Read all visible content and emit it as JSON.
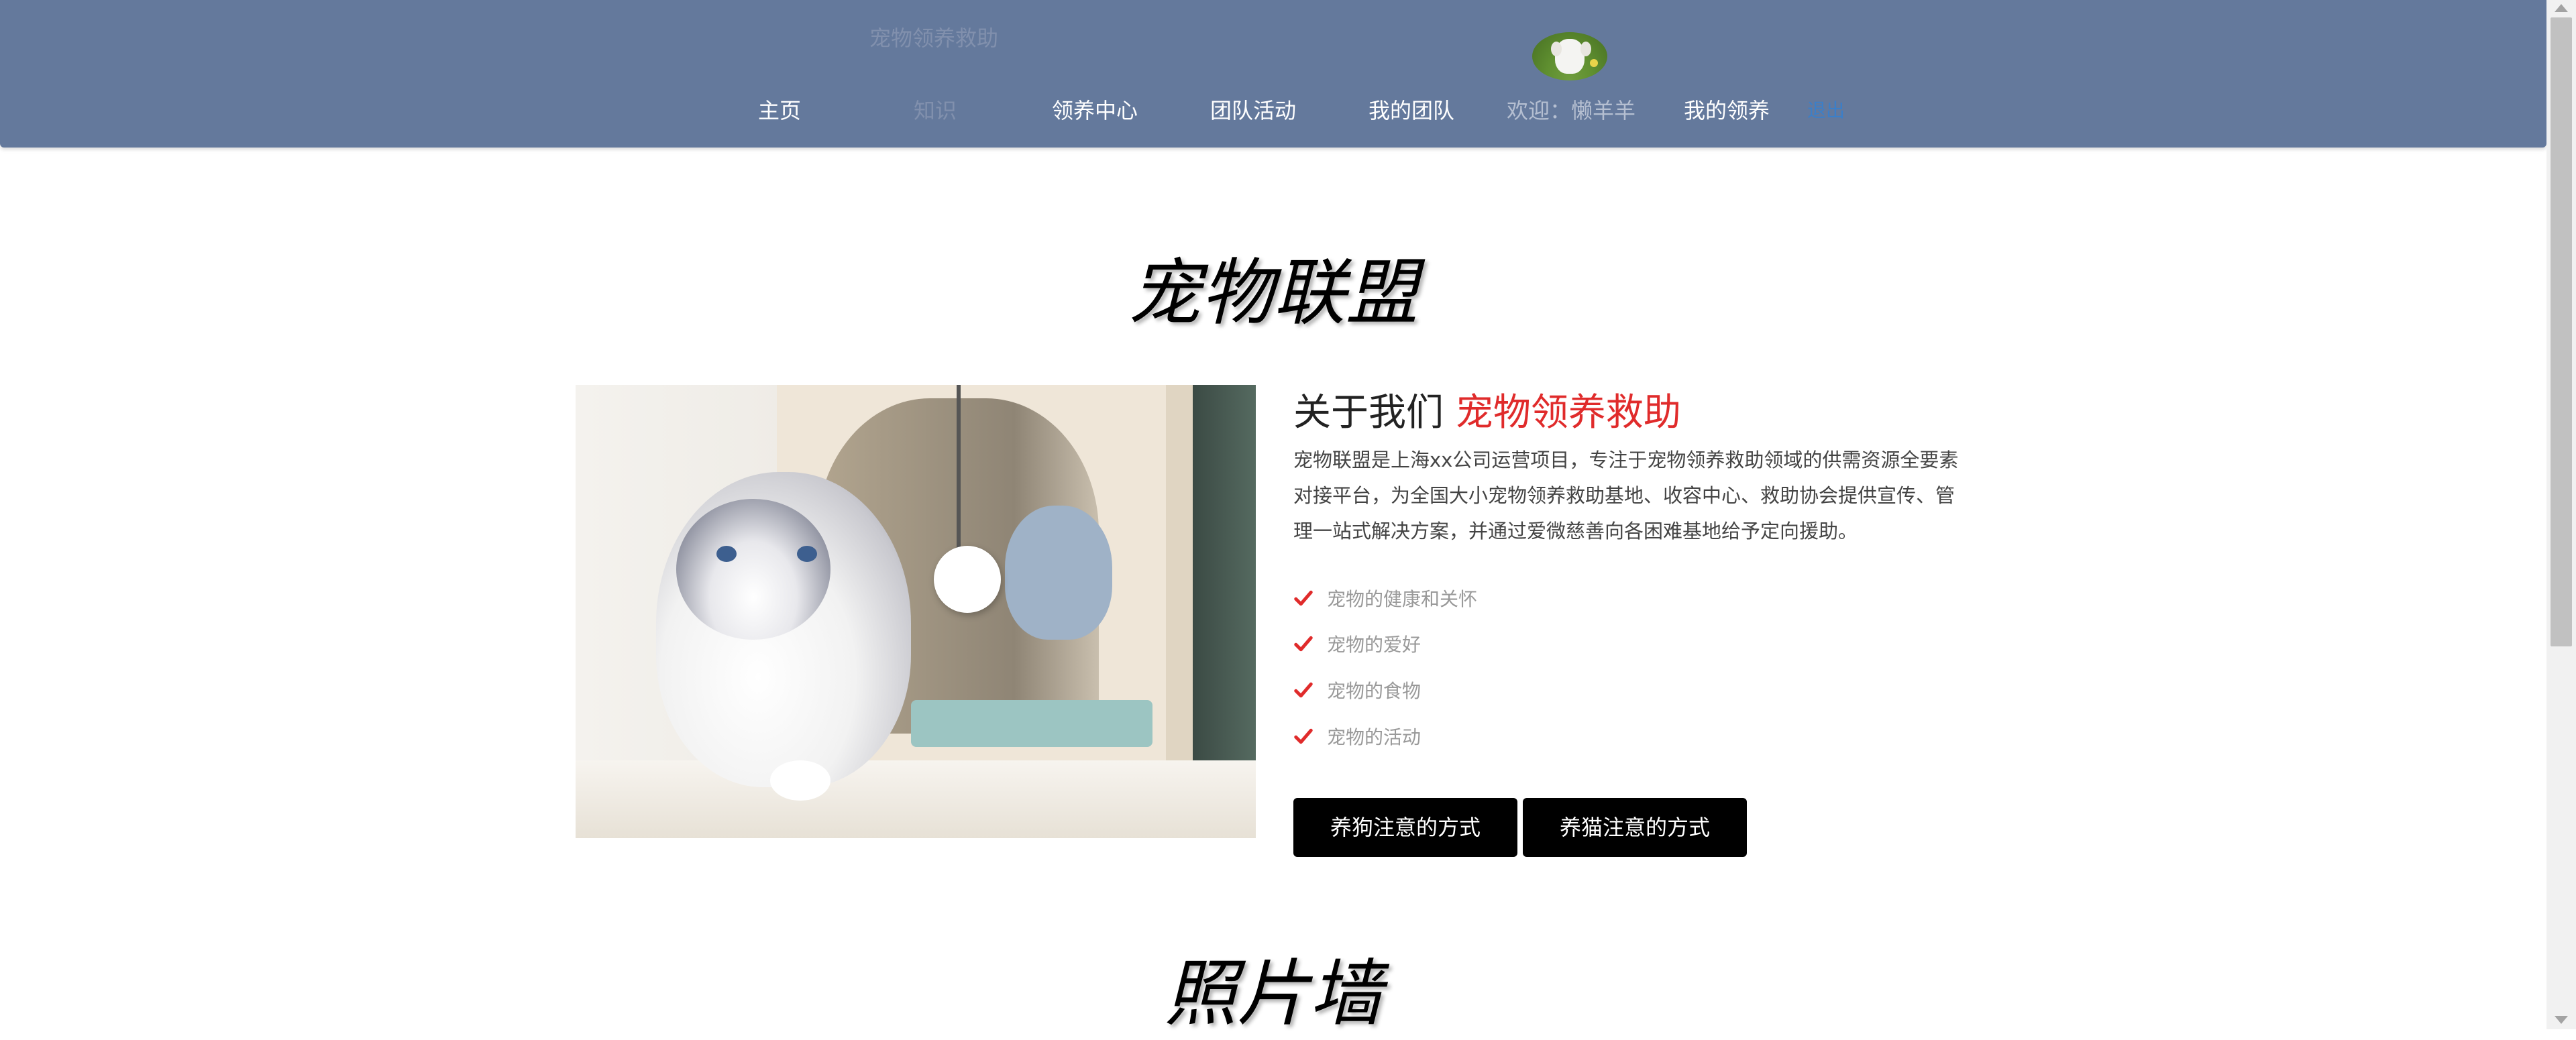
{
  "header": {
    "brand": "宠物领养救助",
    "nav": [
      {
        "label": "主页"
      },
      {
        "label": "知识"
      },
      {
        "label": "领养中心"
      },
      {
        "label": "团队活动"
      },
      {
        "label": "我的团队"
      },
      {
        "label": "欢迎：懒羊羊"
      },
      {
        "label": "我的领养"
      },
      {
        "label": "退出"
      }
    ]
  },
  "main": {
    "title": "宠物联盟",
    "about": {
      "heading": "关于我们",
      "heading_accent": "宠物领养救助",
      "paragraph": "宠物联盟是上海xx公司运营项目，专注于宠物领养救助领域的供需资源全要素对接平台，为全国大小宠物领养救助基地、收容中心、救助协会提供宣传、管理一站式解决方案，并通过爱微慈善向各困难基地给予定向援助。",
      "features": [
        "宠物的健康和关怀",
        "宠物的爱好",
        "宠物的食物",
        "宠物的活动"
      ],
      "buttons": [
        "养狗注意的方式",
        "养猫注意的方式"
      ]
    },
    "gallery_title": "照片墙"
  },
  "colors": {
    "header_bg": "#64799c",
    "accent": "#e02b2b",
    "button_bg": "#000000",
    "link": "#3b7fc9"
  },
  "icons": {
    "feature_marker": "check-icon",
    "avatar": "dog-avatar"
  }
}
